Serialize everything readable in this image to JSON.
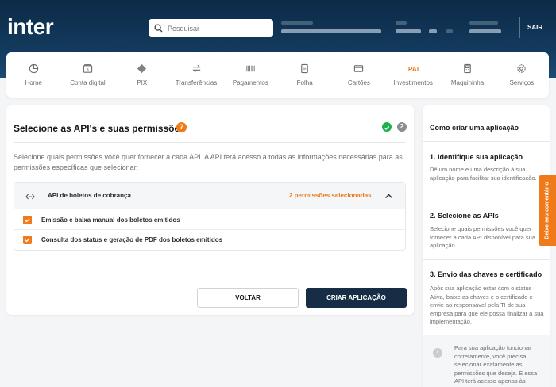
{
  "header": {
    "logo": "inter",
    "search_placeholder": "Pesquisar",
    "logout_label": "SAIR"
  },
  "nav": [
    {
      "label": "Home",
      "icon": "pie-chart-icon"
    },
    {
      "label": "Conta digital",
      "icon": "wallet-icon"
    },
    {
      "label": "PIX",
      "icon": "pix-icon"
    },
    {
      "label": "Transferências",
      "icon": "transfer-icon"
    },
    {
      "label": "Pagamentos",
      "icon": "barcode-icon"
    },
    {
      "label": "Folha",
      "icon": "document-icon"
    },
    {
      "label": "Cartões",
      "icon": "card-icon"
    },
    {
      "label": "Investimentos",
      "icon": "investment-icon"
    },
    {
      "label": "Maquininha",
      "icon": "pos-machine-icon"
    },
    {
      "label": "Serviços",
      "icon": "gear-icon"
    }
  ],
  "main": {
    "title": "Selecione as API's e suas permissões",
    "help_symbol": "?",
    "step_current": "2",
    "description": "Selecione quais permissões você quer fornecer a cada API. A API terá acesso à todas as informações necessárias para as permissões específicas que selecionar:",
    "api": {
      "name": "API de boletos de cobrança",
      "selected_count": "2 permissões selecionadas",
      "permissions": [
        {
          "label": "Emissão e baixa manual dos boletos emitidos",
          "checked": true
        },
        {
          "label": "Consulta dos status e geração de PDF dos boletos emitidos",
          "checked": true
        }
      ]
    },
    "back_label": "VOLTAR",
    "create_label": "CRIAR APLICAÇÃO"
  },
  "side": {
    "title": "Como criar uma aplicação",
    "steps": [
      {
        "heading": "1. Identifique sua aplicação",
        "text": "Dê um nome e uma descrição à sua aplicação para facilitar sua identificação."
      },
      {
        "heading": "2. Selecione as APIs",
        "text": "Selecione quais permissões você quer fornecer a cada API disponível para sua aplicação."
      },
      {
        "heading": "3. Envio das chaves e certificado",
        "text": "Após sua aplicação estar com o status Ativa, baixe as chaves e o certificado e envie ao responsável pela TI de sua empresa para que ele possa finalizar a sua implementação."
      }
    ],
    "info_symbol": "!",
    "info": "Para sua aplicação funcionar corretamente, você precisa selecionar exatamente as permissões que deseja. E essa API terá acesso apenas às informações das"
  },
  "feedback_label": "Deixe seu comentário",
  "colors": {
    "brand_orange": "#ef7a1a",
    "header_dark": "#0c2b47",
    "primary_button": "#172d45",
    "success": "#20b04b"
  }
}
